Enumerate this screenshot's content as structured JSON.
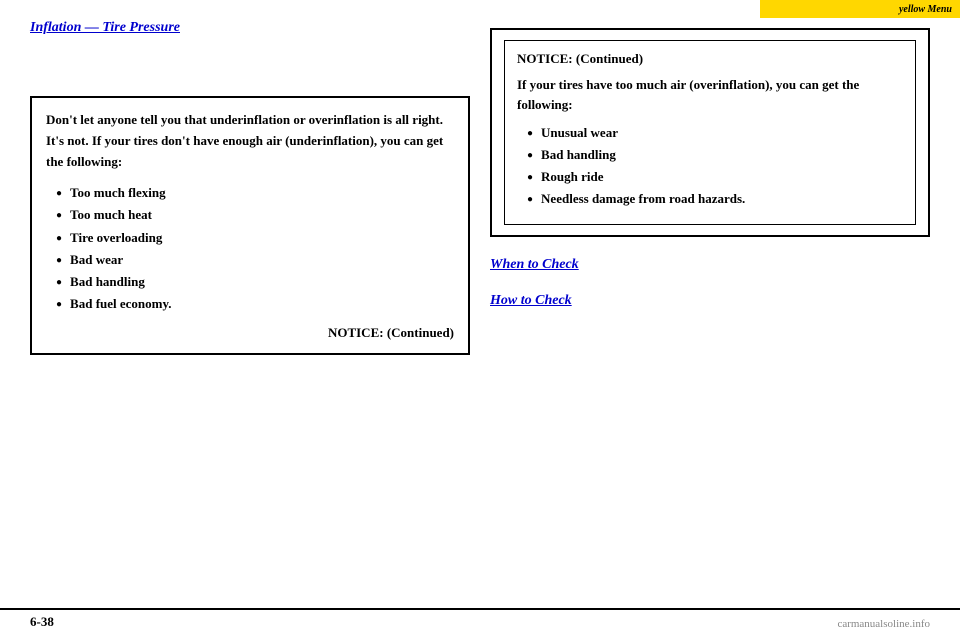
{
  "topbar": {
    "text": "yellow Menu"
  },
  "page_number": "6-38",
  "bottom_logo": "carmanualsoline.info",
  "left_heading": "Inflation — Tire Pressure",
  "left_body_lines": [
    "",
    "",
    ""
  ],
  "warning_box": {
    "intro": "Don't let anyone tell you that underinflation or overinflation is all right. It's not. If your tires don't have enough air (underinflation), you can get the following:",
    "bullets": [
      "Too much flexing",
      "Too much heat",
      "Tire overloading",
      "Bad wear",
      "Bad handling",
      "Bad fuel economy."
    ],
    "continued": "NOTICE: (Continued)"
  },
  "right_notice": {
    "title": "NOTICE: (Continued)",
    "intro": "If your tires have too much air (overinflation), you can get the following:",
    "bullets": [
      "Unusual wear",
      "Bad handling",
      "Rough ride",
      "Needless damage from road hazards."
    ]
  },
  "when_to_check": {
    "heading": "When to Check",
    "body": ""
  },
  "how_to_check": {
    "heading": "How to Check",
    "body": ""
  }
}
